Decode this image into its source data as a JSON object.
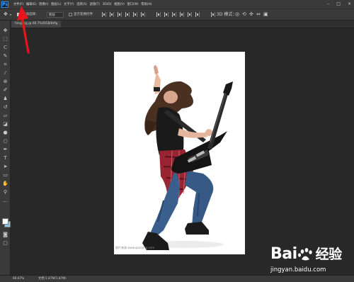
{
  "app": {
    "logo": "Ps"
  },
  "menubar": {
    "items": [
      "文件(F)",
      "编辑(E)",
      "图像(I)",
      "图层(L)",
      "文字(Y)",
      "选择(S)",
      "滤镜(T)",
      "3D(D)",
      "视图(V)",
      "窗口(W)",
      "帮助(H)"
    ]
  },
  "window_controls": {
    "minimize": "–",
    "maximize": "□",
    "close": "×"
  },
  "options": {
    "auto_select_label": "自动选择：",
    "auto_select_value": "图层",
    "transform_label": "显示变换控件"
  },
  "document": {
    "tab_label": "timg.jpg @ 66.7%(RGB/8#)",
    "close": "×",
    "image_credit": "图片来源 www.quanjing.com"
  },
  "status": {
    "zoom": "66.67%",
    "doc_info": "文档:1.87M/1.87M"
  },
  "watermark": {
    "brand": "Bai",
    "brand2": "经验",
    "url": "jingyan.baidu.com"
  },
  "colors": {
    "foreground": "#ffffff",
    "background": "#8fc4e8",
    "accent_arrow": "#e8141c",
    "ps_blue": "#2c8ee8"
  },
  "icons": [
    "move-icon",
    "marquee-icon",
    "lasso-icon",
    "quick-select-icon",
    "crop-icon",
    "eyedropper-icon",
    "healing-icon",
    "brush-icon",
    "stamp-icon",
    "history-brush-icon",
    "eraser-icon",
    "gradient-icon",
    "blur-icon",
    "dodge-icon",
    "pen-icon",
    "type-icon",
    "path-select-icon",
    "shape-icon",
    "hand-icon",
    "zoom-icon",
    "more-icon"
  ]
}
